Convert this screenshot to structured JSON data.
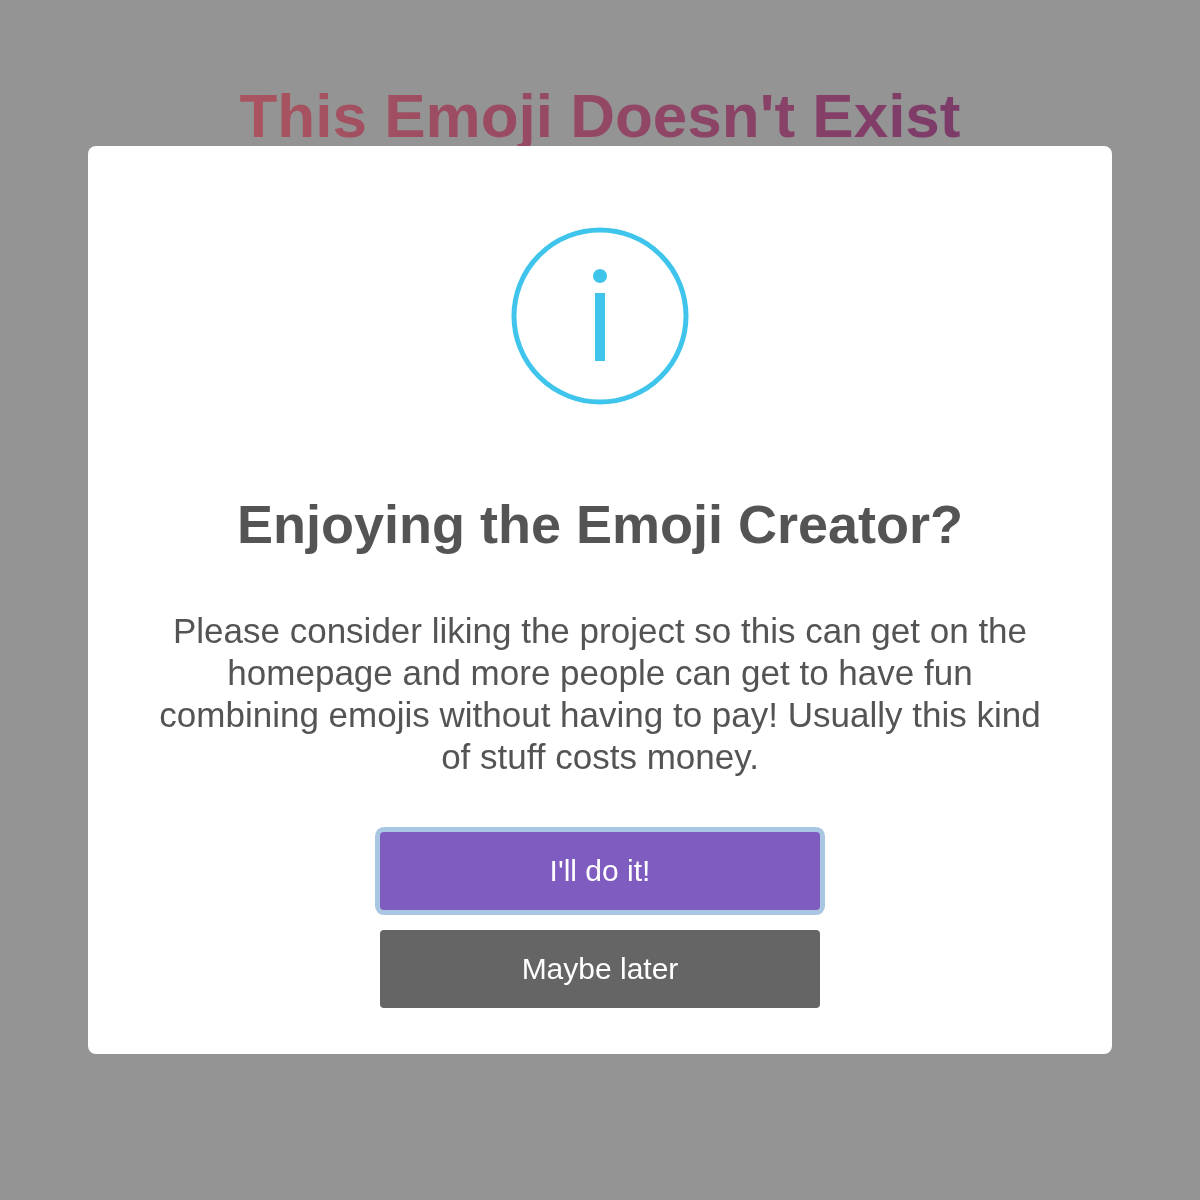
{
  "page_title": "This Emoji Doesn't Exist",
  "dialog": {
    "heading": "Enjoying the Emoji Creator?",
    "message": "Please consider liking the project so this can get on the homepage and more people can get to have fun combining emojis without having to pay! Usually this kind of stuff costs money.",
    "buttons": [
      {
        "label": "I'll do it!",
        "kind": "primary",
        "focused": true
      },
      {
        "label": "Maybe later",
        "kind": "secondary",
        "focused": false
      }
    ]
  }
}
